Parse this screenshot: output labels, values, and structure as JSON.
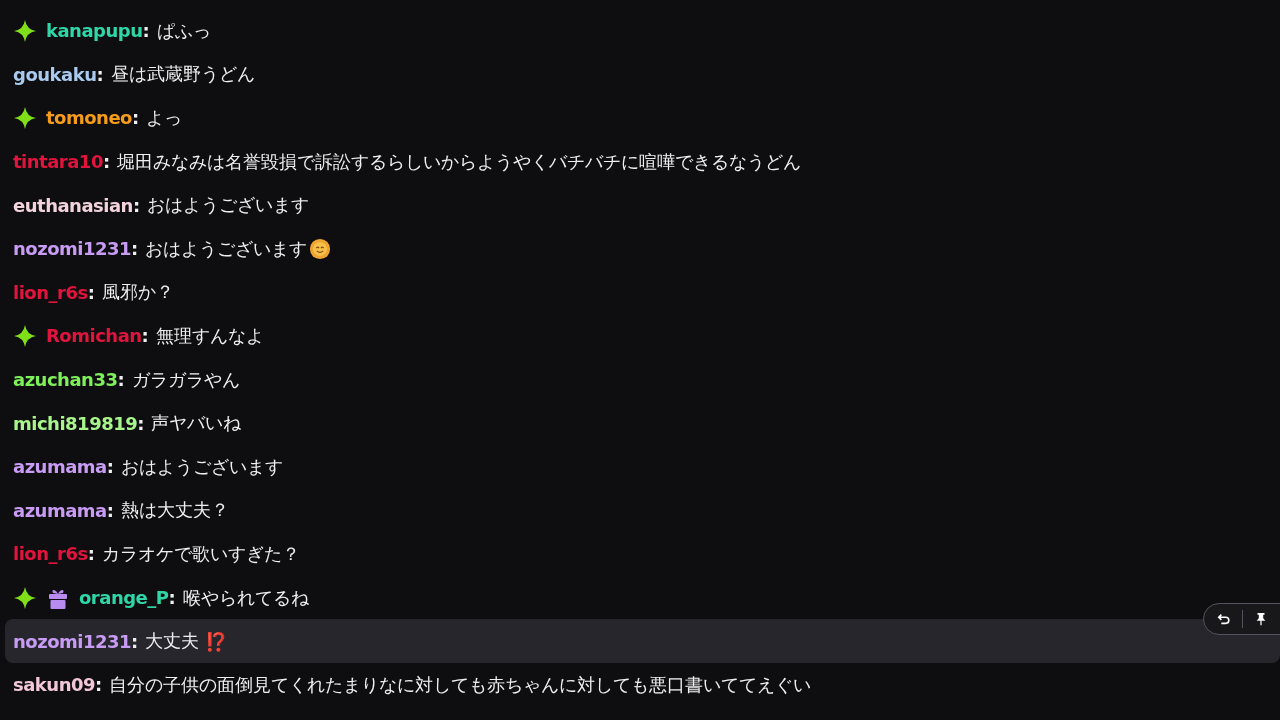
{
  "messages": [
    {
      "badges": [
        {
          "kind": "sparkle"
        }
      ],
      "user": "kanapupu",
      "color": "#2fd7a8",
      "separator": ":",
      "text": "ぱふっ",
      "highlighted": false
    },
    {
      "user": "goukaku",
      "color": "#a9c9ee",
      "separator": ":",
      "text": "昼は武蔵野うどん",
      "highlighted": false
    },
    {
      "badges": [
        {
          "kind": "sparkle"
        }
      ],
      "user": "tomoneo",
      "color": "#f59c1a",
      "separator": ":",
      "text": "よっ",
      "highlighted": false
    },
    {
      "user": "tintara10",
      "color": "#e0143c",
      "separator": ":",
      "text": "堀田みなみは名誉毀損で訴訟するらしいからようやくバチバチに喧嘩できるなうどん",
      "highlighted": false
    },
    {
      "user": "euthanasian",
      "color": "#f3d3dc",
      "separator": ":",
      "text": "おはようございます",
      "highlighted": false
    },
    {
      "user": "nozomi1231",
      "color": "#c89cf5",
      "separator": ":",
      "text": "おはようございます",
      "emote": {
        "kind": "sun"
      },
      "highlighted": false
    },
    {
      "user": "lion_r6s",
      "color": "#e0143c",
      "separator": ":",
      "text": "風邪か？",
      "highlighted": false
    },
    {
      "badges": [
        {
          "kind": "sparkle"
        }
      ],
      "user": "Romichan",
      "color": "#e0143c",
      "separator": ":",
      "text": "無理すんなよ",
      "highlighted": false
    },
    {
      "user": "azuchan33",
      "color": "#7ef05a",
      "separator": ":",
      "text": "ガラガラやん",
      "highlighted": false
    },
    {
      "user": "michi819819",
      "color": "#a8f58c",
      "separator": ":",
      "text": "声ヤバいね",
      "highlighted": false
    },
    {
      "user": "azumama",
      "color": "#c89cf5",
      "separator": ":",
      "text": "おはようございます",
      "highlighted": false
    },
    {
      "user": "azumama",
      "color": "#c89cf5",
      "separator": ":",
      "text": "熱は大丈夫？",
      "highlighted": false
    },
    {
      "user": "lion_r6s",
      "color": "#e0143c",
      "separator": ":",
      "text": "カラオケで歌いすぎた？",
      "highlighted": false
    },
    {
      "badges": [
        {
          "kind": "sparkle"
        },
        {
          "kind": "gift"
        }
      ],
      "user": "orange_P",
      "color": "#2fd7a8",
      "separator": ":",
      "text": "喉やられてるね",
      "highlighted": false
    },
    {
      "user": "nozomi1231",
      "color": "#c89cf5",
      "separator": ":",
      "text": "大丈夫",
      "emoji": "⁉️",
      "highlighted": true
    },
    {
      "user": "sakun09",
      "color": "#f3c7d6",
      "separator": ":",
      "text": "自分の子供の面倒見てくれたまりなに対しても赤ちゃんに対しても悪口書いててえぐい",
      "highlighted": false
    }
  ]
}
